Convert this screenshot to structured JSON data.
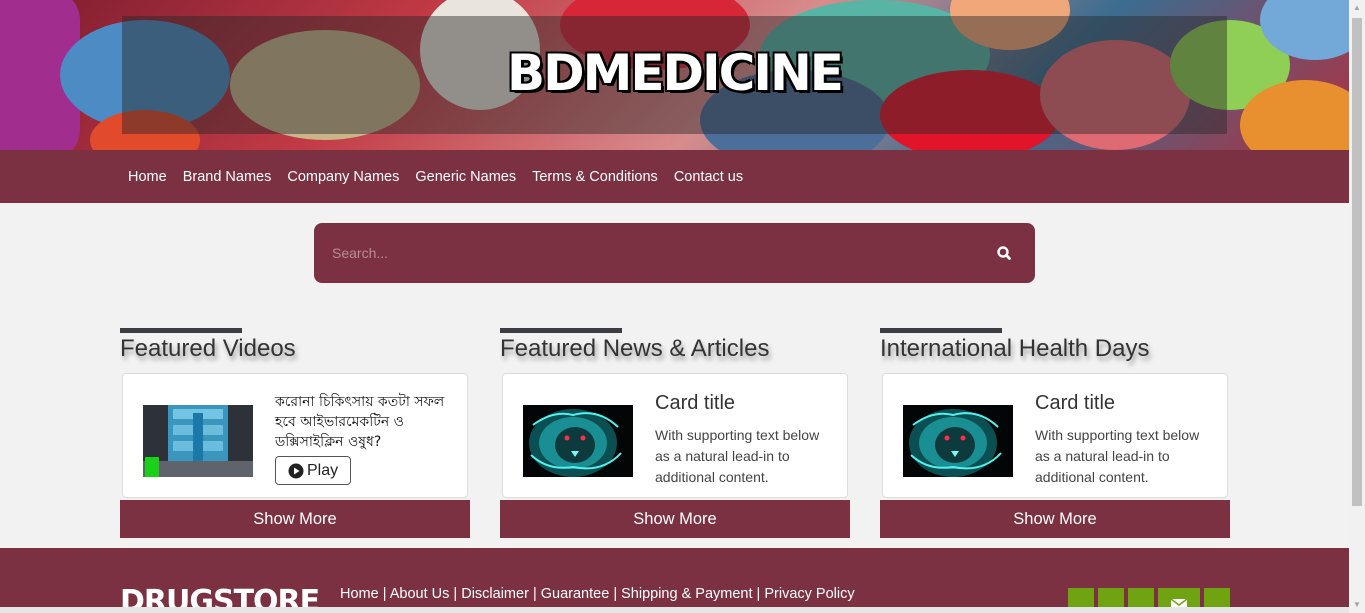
{
  "header": {
    "site_title": "BDMEDICINE"
  },
  "nav": {
    "items": [
      {
        "label": "Home"
      },
      {
        "label": "Brand Names"
      },
      {
        "label": "Company Names"
      },
      {
        "label": "Generic Names"
      },
      {
        "label": "Terms & Conditions"
      },
      {
        "label": "Contact us"
      }
    ]
  },
  "search": {
    "placeholder": "Search...",
    "icon": "search-icon"
  },
  "sections": [
    {
      "title": "Featured Videos",
      "card": {
        "image": "video-thumbnail",
        "text": "করোনা চিকিৎসায় কতটা সফল হবে আইভারমেকটিন ও ডক্সিসাইক্লিন ওষুধ?",
        "play_label": "Play",
        "play_icon": "play-circle-icon"
      },
      "show_more": "Show More"
    },
    {
      "title": "Featured News & Articles",
      "card": {
        "image": "neon-lion-image",
        "title": "Card title",
        "text": "With supporting text below as a natural lead-in to additional content."
      },
      "show_more": "Show More"
    },
    {
      "title": "International Health Days",
      "card": {
        "image": "neon-lion-image",
        "title": "Card title",
        "text": "With supporting text below as a natural lead-in to additional content."
      },
      "show_more": "Show More"
    }
  ],
  "footer": {
    "logo": "DRUGSTORE",
    "links": [
      {
        "label": "Home"
      },
      {
        "label": "About Us"
      },
      {
        "label": "Disclaimer"
      },
      {
        "label": "Guarantee"
      },
      {
        "label": "Shipping & Payment"
      },
      {
        "label": "Privacy Policy"
      }
    ],
    "separator": "|",
    "social_icons": [
      "social-icon",
      "social-icon",
      "social-icon",
      "envelope-icon",
      "social-icon"
    ]
  },
  "colors": {
    "primary": "#7b3141",
    "background": "#f2f2f2",
    "social_green": "#6fa312",
    "section_bar": "#3d3e44"
  }
}
